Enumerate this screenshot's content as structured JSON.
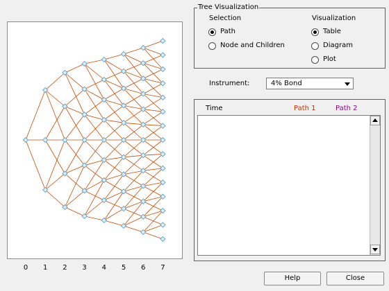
{
  "tree": {
    "x_ticks": [
      "0",
      "1",
      "2",
      "3",
      "4",
      "5",
      "6",
      "7"
    ],
    "node_color": "#5aa0c8",
    "edge_color": "#cc4a00"
  },
  "visualization_group": {
    "title": "Tree Visualization",
    "selection_heading": "Selection",
    "visualization_heading": "Visualization",
    "selection_options": [
      {
        "label": "Path",
        "selected": true
      },
      {
        "label": "Node and Children",
        "selected": false
      }
    ],
    "visualization_options": [
      {
        "label": "Table",
        "selected": true
      },
      {
        "label": "Diagram",
        "selected": false
      },
      {
        "label": "Plot",
        "selected": false
      }
    ]
  },
  "instrument": {
    "label": "Instrument:",
    "value": "4% Bond"
  },
  "table": {
    "col_time": "Time",
    "col_path1": "Path 1",
    "col_path2": "Path 2",
    "path1_color": "#d03000",
    "path2_color": "#9a0090"
  },
  "buttons": {
    "help": "Help",
    "close": "Close"
  }
}
